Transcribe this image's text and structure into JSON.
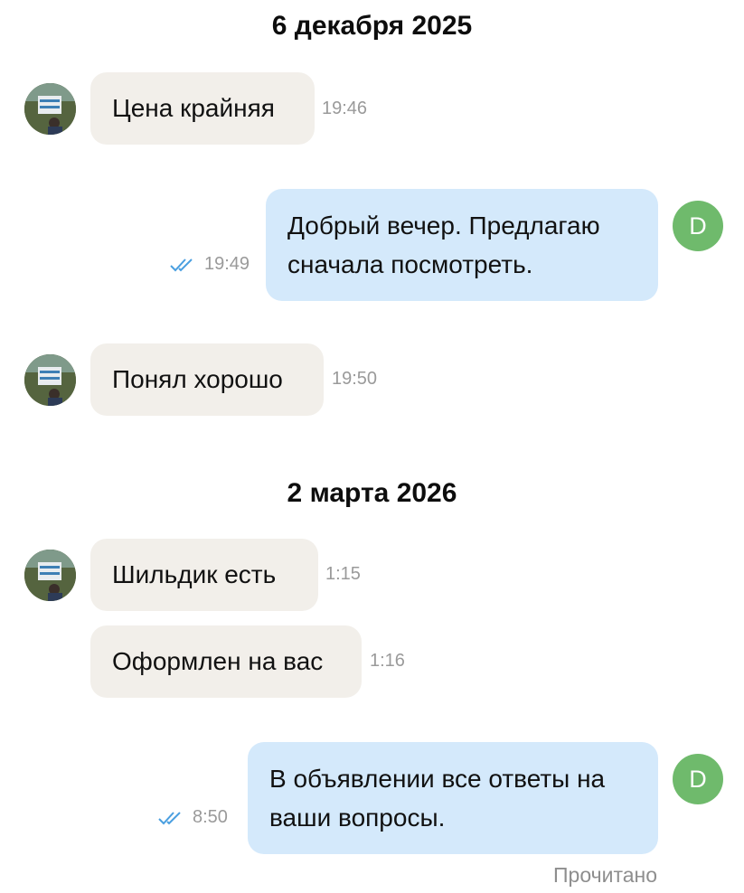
{
  "dates": [
    "6 декабря 2025",
    "2 марта 2026"
  ],
  "messages": [
    {
      "text": "Цена крайняя",
      "time": "19:46"
    },
    {
      "lines": [
        "Добрый вечер. Предлагаю",
        "сначала посмотреть."
      ],
      "time": "19:49"
    },
    {
      "text": "Понял хорошо",
      "time": "19:50"
    },
    {
      "text": "Шильдик есть",
      "time": "1:15"
    },
    {
      "text": "Оформлен на вас",
      "time": "1:16"
    },
    {
      "lines": [
        "В объявлении все ответы на",
        "ваши вопросы."
      ],
      "time": "8:50"
    }
  ],
  "user_avatar_letter": "D",
  "read_status": "Прочитано",
  "colors": {
    "incoming_bubble": "#f2efea",
    "outgoing_bubble": "#d4e9fb",
    "user_avatar": "#6fba6c",
    "read_check": "#4a9fe0"
  }
}
